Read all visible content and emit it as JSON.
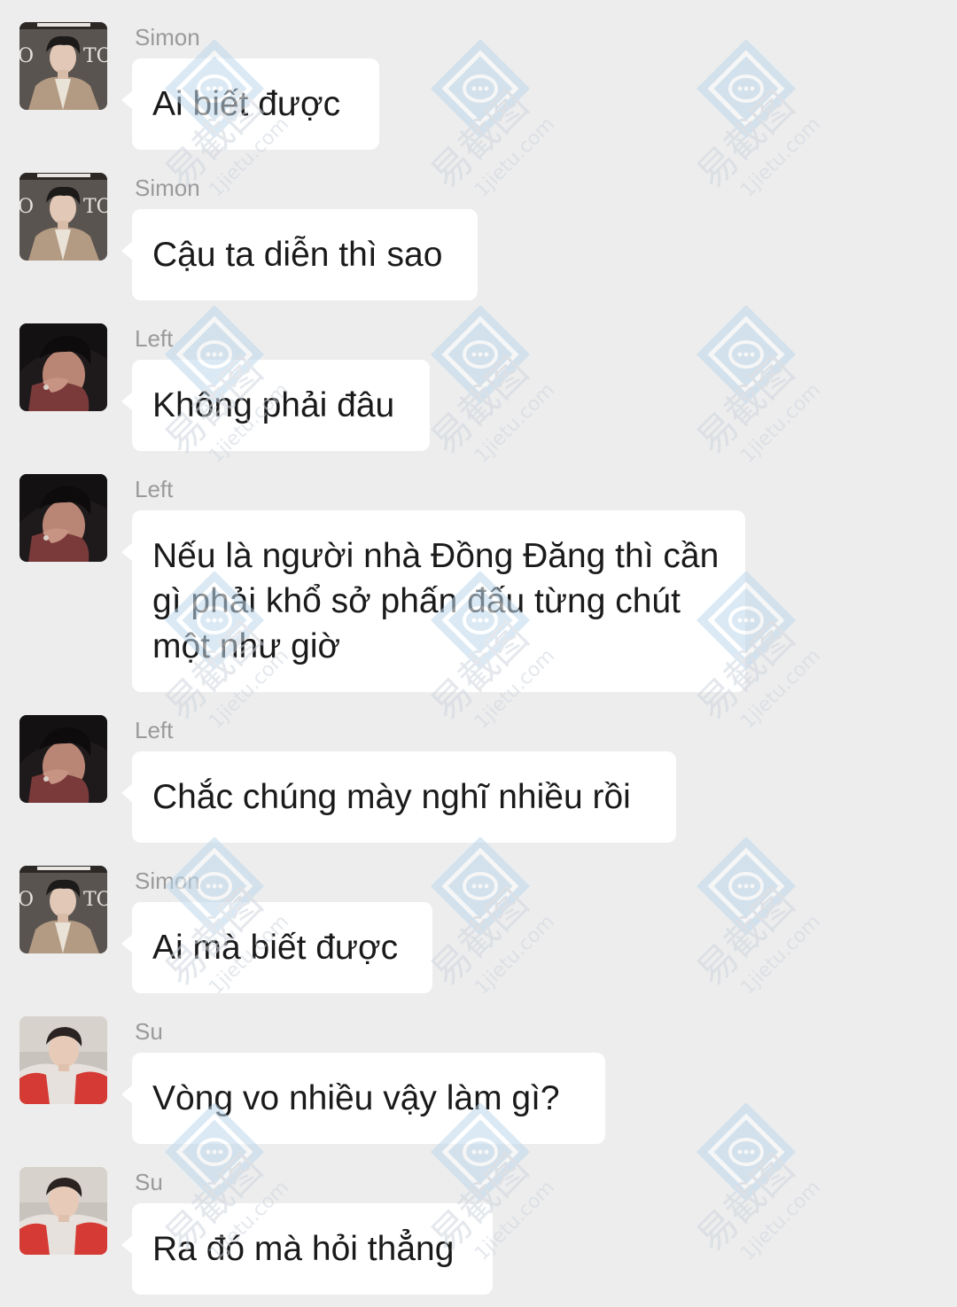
{
  "messages": [
    {
      "sender": "Simon",
      "text": "Ai biết được",
      "avatar_icon": "simon-avatar-icon"
    },
    {
      "sender": "Simon",
      "text": "Cậu ta diễn thì sao",
      "avatar_icon": "simon-avatar-icon"
    },
    {
      "sender": "Left",
      "text": "Không phải đâu",
      "avatar_icon": "left-avatar-icon"
    },
    {
      "sender": "Left",
      "text": "Nếu là người nhà Đồng Đăng thì cần gì phải khổ sở phấn đấu từng chút một như giờ",
      "avatar_icon": "left-avatar-icon"
    },
    {
      "sender": "Left",
      "text": "Chắc chúng mày nghĩ nhiều rồi",
      "avatar_icon": "left-avatar-icon"
    },
    {
      "sender": "Simon",
      "text": "Ai mà biết được",
      "avatar_icon": "simon-avatar-icon"
    },
    {
      "sender": "Su",
      "text": "Vòng vo nhiều vậy làm gì?",
      "avatar_icon": "su-avatar-icon"
    },
    {
      "sender": "Su",
      "text": "Ra đó mà hỏi thẳng",
      "avatar_icon": "su-avatar-icon"
    }
  ],
  "watermark": {
    "text": "易截图",
    "url": "1jietu.com",
    "icon": "chat-bubble-diamond-icon"
  },
  "colors": {
    "background": "#ededed",
    "bubble": "#ffffff",
    "sender_name": "#9a9a9a",
    "text": "#1a1a1a"
  }
}
